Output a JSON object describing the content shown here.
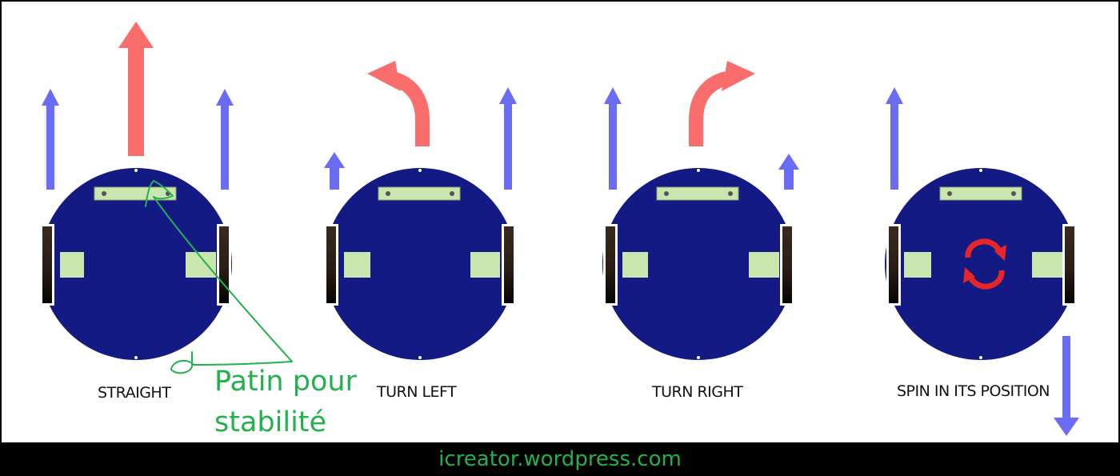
{
  "diagram": {
    "panels": [
      {
        "label": "STRAIGHT"
      },
      {
        "label": "TURN LEFT"
      },
      {
        "label": "TURN RIGHT"
      },
      {
        "label": "SPIN IN ITS POSITION"
      }
    ],
    "annotation": {
      "line1": "Patin pour",
      "line2": "stabilité",
      "color": "#22b14c"
    },
    "colors": {
      "body": "#141a83",
      "wheel_arrow": "#6a6cf4",
      "direction_arrow": "#f96d6d",
      "caster": "#c9e6ae",
      "spin_icon": "#e8262a"
    }
  },
  "footer": {
    "text": "icreator.wordpress.com"
  }
}
